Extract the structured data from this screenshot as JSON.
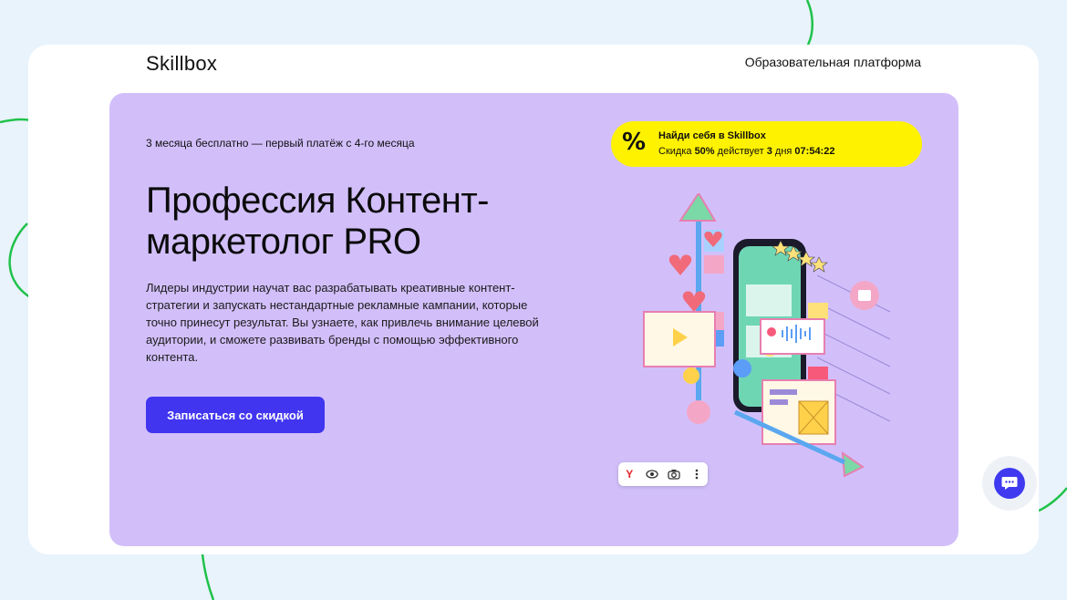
{
  "header": {
    "logo": "Skillbox",
    "platform_label": "Образовательная платформа"
  },
  "hero": {
    "promo": "3 месяца бесплатно — первый платёж с 4-го месяца",
    "title": "Профессия Контент-маркетолог PRO",
    "description": "Лидеры индустрии научат вас разрабатывать креативные контент-стратегии и запускать нестандартные рекламные кампании, которые точно принесут результат. Вы узнаете, как привлечь внимание целевой аудитории, и сможете развивать бренды с помощью эффективного контента.",
    "cta_label": "Записаться со скидкой"
  },
  "timer_badge": {
    "icon_glyph": "%",
    "title": "Найди себя в Skillbox",
    "discount_prefix": "Скидка",
    "discount_value": "50%",
    "discount_mid": "действует",
    "days": "3",
    "days_label": "дня",
    "time": "07:54:22"
  },
  "image_toolbar": {
    "icons": [
      "yandex-icon",
      "eye-icon",
      "camera-icon",
      "more-icon"
    ],
    "yandex_glyph": "Y"
  },
  "colors": {
    "page_bg": "#e9f3fc",
    "hero_bg": "#d2bffa",
    "cta_bg": "#4135f0",
    "timer_bg": "#fff200",
    "accent_green": "#1fc24a"
  }
}
